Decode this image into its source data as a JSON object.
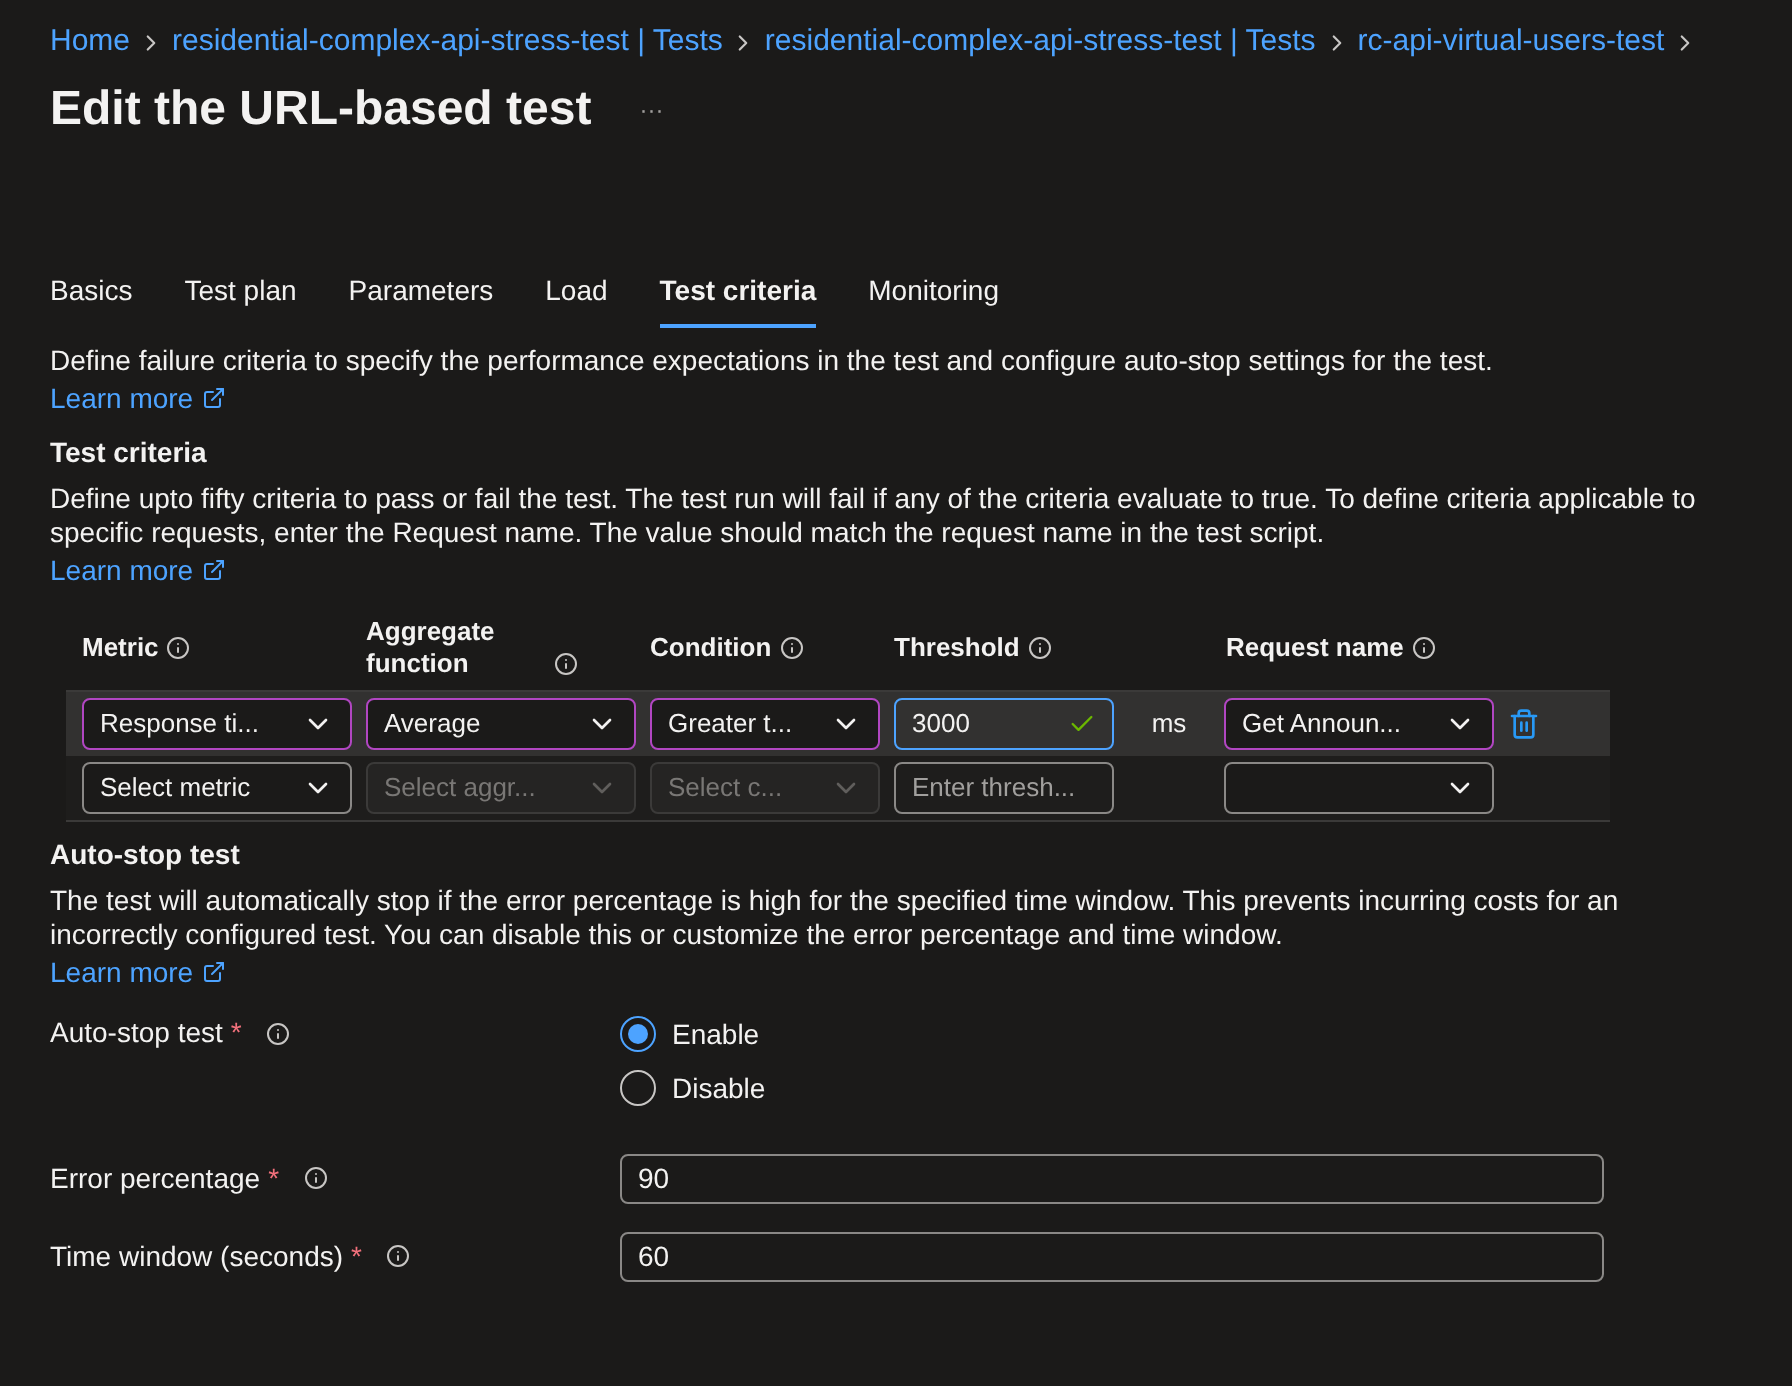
{
  "breadcrumb": [
    "Home",
    "residential-complex-api-stress-test | Tests",
    "residential-complex-api-stress-test | Tests",
    "rc-api-virtual-users-test"
  ],
  "title": "Edit the URL-based test",
  "more": "···",
  "tabs": [
    {
      "label": "Basics",
      "selected": false
    },
    {
      "label": "Test plan",
      "selected": false
    },
    {
      "label": "Parameters",
      "selected": false
    },
    {
      "label": "Load",
      "selected": false
    },
    {
      "label": "Test criteria",
      "selected": true
    },
    {
      "label": "Monitoring",
      "selected": false
    }
  ],
  "intro": {
    "text": "Define failure criteria to specify the performance expectations in the test and configure auto-stop settings for the test.",
    "link": "Learn more"
  },
  "criteria": {
    "heading": "Test criteria",
    "text": "Define upto fifty criteria to pass or fail the test. The test run will fail if any of the criteria evaluate to true. To define criteria applicable to specific requests, enter the Request name. The value should match the request name in the test script.",
    "link": "Learn more",
    "columns": [
      "Metric",
      "Aggregate function",
      "Condition",
      "Threshold",
      "Request name"
    ],
    "rows": [
      {
        "selected": true,
        "metric": {
          "value": "Response ti...",
          "disabled": false
        },
        "aggregate": {
          "value": "Average",
          "disabled": false
        },
        "condition": {
          "value": "Greater t...",
          "disabled": false
        },
        "threshold": {
          "value": "3000",
          "valid": true
        },
        "unit": "ms",
        "request": {
          "value": "Get Announ...",
          "disabled": false
        },
        "deletable": true
      },
      {
        "selected": false,
        "metric": {
          "placeholder": "Select metric",
          "disabled": false
        },
        "aggregate": {
          "placeholder": "Select aggr...",
          "disabled": true
        },
        "condition": {
          "placeholder": "Select c...",
          "disabled": true
        },
        "threshold": {
          "placeholder": "Enter thresh...",
          "valid": false
        },
        "request": {
          "disabled": false
        },
        "deletable": false
      }
    ]
  },
  "autostop": {
    "heading": "Auto-stop test",
    "text": "The test will automatically stop if the error percentage is high for the specified time window. This prevents incurring costs for an incorrectly configured test. You can disable this or customize the error percentage and time window.",
    "link": "Learn more",
    "toggle": {
      "label": "Auto-stop test",
      "required_mark": "*",
      "options": [
        {
          "label": "Enable",
          "selected": true
        },
        {
          "label": "Disable",
          "selected": false
        }
      ]
    },
    "fields": [
      {
        "label": "Error percentage",
        "required_mark": "*",
        "value": "90"
      },
      {
        "label": "Time window (seconds)",
        "required_mark": "*",
        "value": "60"
      }
    ]
  }
}
